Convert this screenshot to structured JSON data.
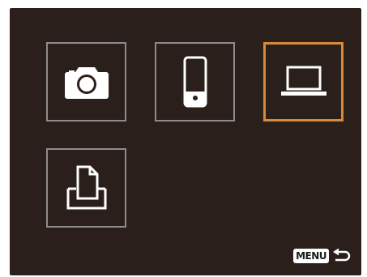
{
  "screen": {
    "background_color": "#2a1f1a",
    "tile_border_color": "#8c8c8c",
    "selected_border_color": "#d9893a"
  },
  "tiles": [
    {
      "icon": "camera-icon",
      "selected": false
    },
    {
      "icon": "smartphone-icon",
      "selected": false
    },
    {
      "icon": "computer-icon",
      "selected": true
    },
    {
      "icon": "printer-icon",
      "selected": false
    }
  ],
  "footer": {
    "menu_label": "MENU",
    "back_icon": "back-arrow-icon"
  }
}
